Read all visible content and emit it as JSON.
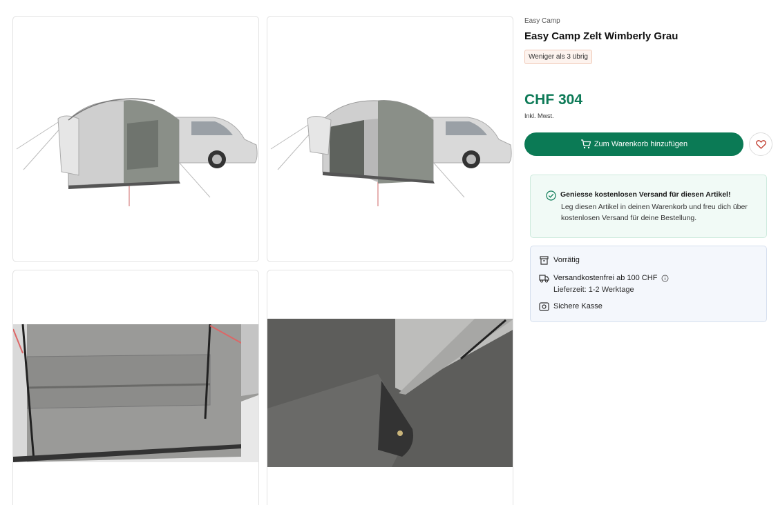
{
  "product": {
    "brand": "Easy Camp",
    "title": "Easy Camp Zelt Wimberly Grau",
    "stock_badge": "Weniger als 3 übrig",
    "price": "CHF 304",
    "vat_note": "Inkl. Mwst."
  },
  "actions": {
    "add_to_cart": "Zum Warenkorb hinzufügen",
    "cart_icon": "cart-icon",
    "wishlist_icon": "heart-icon"
  },
  "shipping_promo": {
    "title": "Geniesse kostenlosen Versand für diesen Artikel!",
    "line1": "Leg diesen Artikel in deinen Warenkorb und freu dich über",
    "line2": "kostenlosen Versand für deine Bestellung."
  },
  "availability": {
    "stock": "Vorrätig",
    "shipping": "Versandkostenfrei ab 100 CHF",
    "delivery": "Lieferzeit: 1-2 Werktage",
    "checkout": "Sichere Kasse"
  },
  "colors": {
    "brand_green": "#0b7a55",
    "price_green": "#0d7a57",
    "badge_bg": "#fdf3ee",
    "promo_bg": "#f1faf6",
    "info_bg": "#f4f7fc"
  }
}
